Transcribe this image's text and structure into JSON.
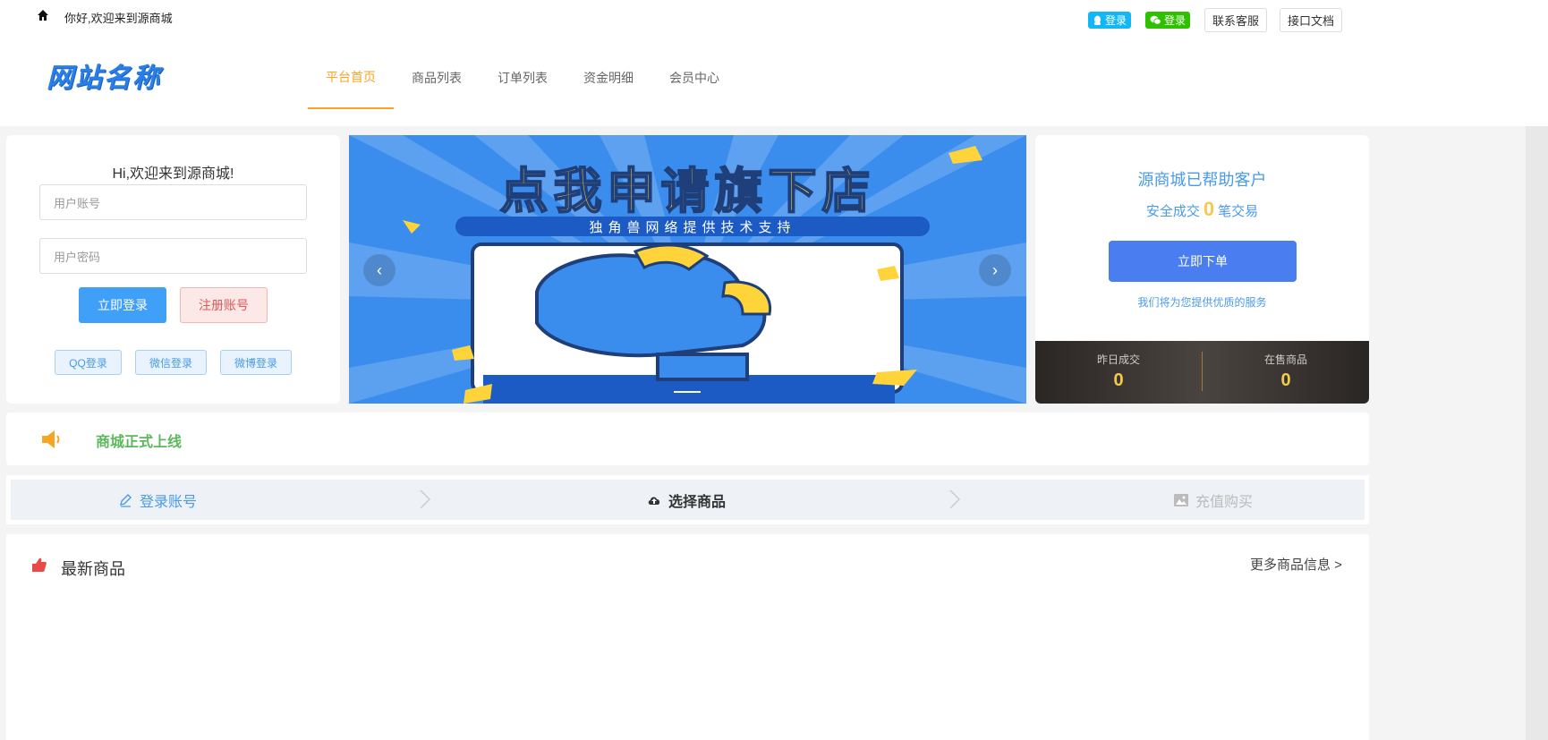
{
  "topbar": {
    "welcome": "你好,欢迎来到源商城",
    "qq_login": "登录",
    "wechat_login": "登录",
    "contact_service": "联系客服",
    "api_docs": "接口文档"
  },
  "header": {
    "logo_text": "网站名称",
    "nav": [
      {
        "label": "平台首页",
        "active": true
      },
      {
        "label": "商品列表",
        "active": false
      },
      {
        "label": "订单列表",
        "active": false
      },
      {
        "label": "资金明细",
        "active": false
      },
      {
        "label": "会员中心",
        "active": false
      }
    ]
  },
  "login": {
    "title": "Hi,欢迎来到源商城!",
    "username_placeholder": "用户账号",
    "password_placeholder": "用户密码",
    "login_button": "立即登录",
    "register_button": "注册账号",
    "qq_login": "QQ登录",
    "wechat_login": "微信登录",
    "weibo_login": "微博登录"
  },
  "banner": {
    "title": "点我申请旗下店",
    "subtitle": "独角兽网络提供技术支持",
    "prev": "‹",
    "next": "›"
  },
  "stats": {
    "line1": "源商城已帮助客户",
    "line2_prefix": "安全成交",
    "deals": "0",
    "line2_suffix": "笔交易",
    "order_button": "立即下单",
    "service_note": "我们将为您提供优质的服务",
    "yesterday_label": "昨日成交",
    "yesterday_value": "0",
    "on_sale_label": "在售商品",
    "on_sale_value": "0"
  },
  "notice": {
    "text": "商城正式上线"
  },
  "steps": [
    {
      "label": "登录账号",
      "state": "done"
    },
    {
      "label": "选择商品",
      "state": "current"
    },
    {
      "label": "充值购买",
      "state": "pending"
    }
  ],
  "products": {
    "title": "最新商品",
    "more": "更多商品信息 >"
  },
  "colors": {
    "accent": "#f5a623",
    "primary": "#40a0f7",
    "gold": "#f5c94d",
    "notice_green": "#5cb85c"
  }
}
